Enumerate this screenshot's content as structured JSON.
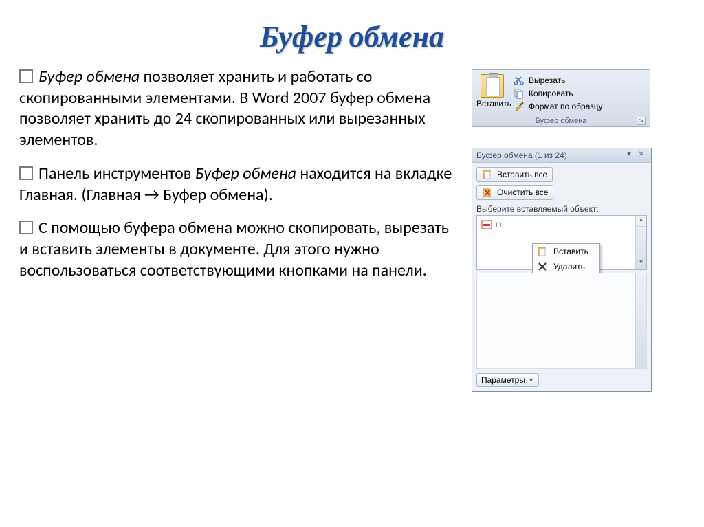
{
  "title": "Буфер обмена",
  "bullets": {
    "p1_em": "Буфер обмена",
    "p1_rest": " позволяет хранить и работать со скопированными элементами. В Word 2007 буфер обмена позволяет хранить до 24 скопированных или вырезанных элементов.",
    "p2_a": "Панель инструментов ",
    "p2_em": "Буфер обмена",
    "p2_b": " находится на вкладке Главная.  (Главная → Буфер обмена).",
    "p3": "С помощью буфера обмена можно скопировать, вырезать и вставить элементы в документе. Для этого нужно воспользоваться соответствующими кнопками на панели."
  },
  "ribbon": {
    "paste": "Вставить",
    "cut": "Вырезать",
    "copy": "Копировать",
    "format_painter": "Формат по образцу",
    "group_label": "Буфер обмена"
  },
  "pane": {
    "header": "Буфер обмена (1 из 24)",
    "paste_all": "Вставить все",
    "clear_all": "Очистить все",
    "prompt": "Выберите вставляемый объект:",
    "item_placeholder": "□",
    "ctx_paste": "Вставить",
    "ctx_delete": "Удалить",
    "params": "Параметры"
  }
}
